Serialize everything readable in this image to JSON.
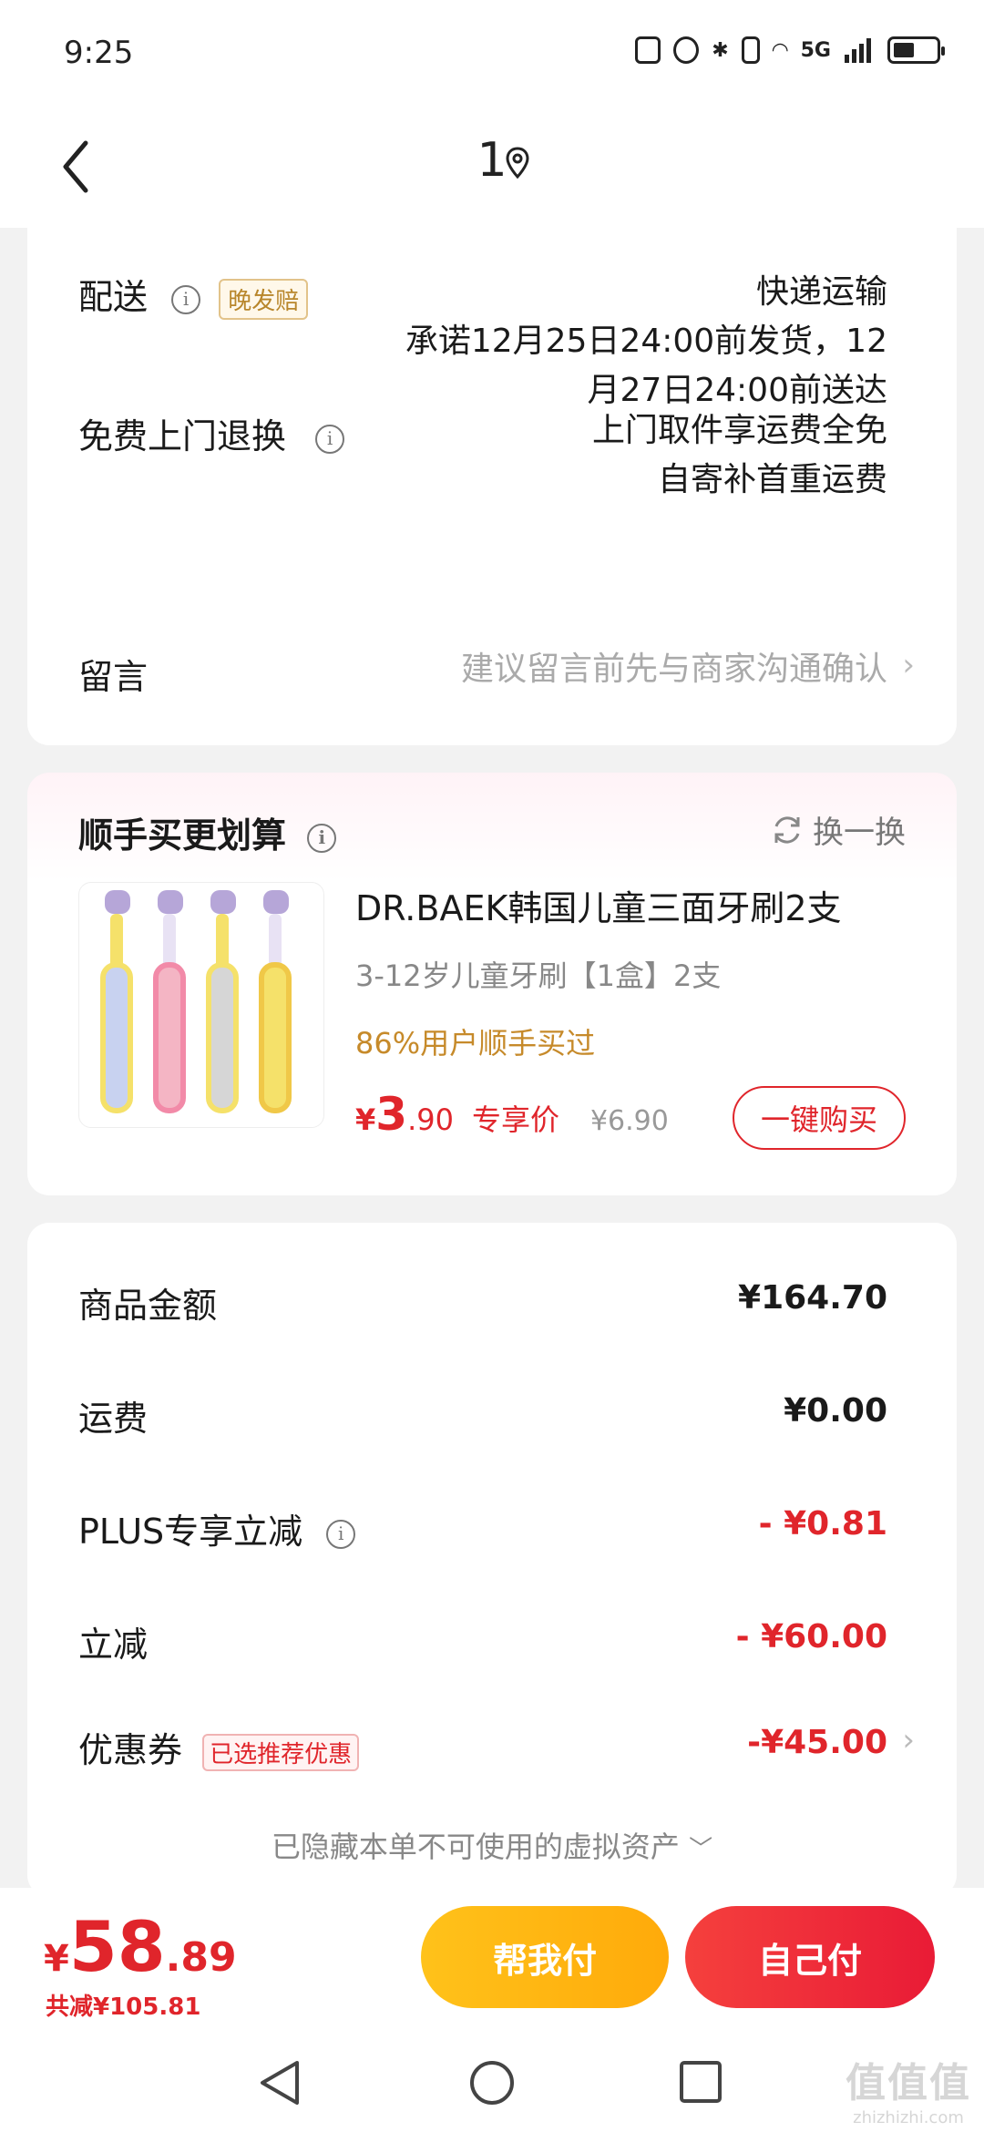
{
  "status_bar": {
    "time": "9:25",
    "network": "5G"
  },
  "nav": {
    "title": "1"
  },
  "delivery": {
    "label": "配送",
    "badge": "晚发赔",
    "method": "快递运输",
    "promise_line1": "承诺12月25日24:00前发货，12",
    "promise_line2": "月27日24:00前送达"
  },
  "returns": {
    "label": "免费上门退换",
    "line1": "上门取件享运费全免",
    "line2": "自寄补首重运费"
  },
  "message": {
    "label": "留言",
    "placeholder": "建议留言前先与商家沟通确认"
  },
  "addon": {
    "title": "顺手买更划算",
    "swap_label": "换一换",
    "product": {
      "name": "DR.BAEK韩国儿童三面牙刷2支",
      "spec": "3-12岁儿童牙刷【1盒】2支",
      "stat": "86%用户顺手买过",
      "currency": "¥",
      "price_int": "3",
      "price_dec": ".90",
      "price_tag": "专享价",
      "original_price": "¥6.90",
      "buy_label": "一键购买"
    }
  },
  "amounts": {
    "goods_label": "商品金额",
    "goods_value": "¥164.70",
    "shipping_label": "运费",
    "shipping_value": "¥0.00",
    "plus_label": "PLUS专享立减",
    "plus_value": "- ¥0.81",
    "discount_label": "立减",
    "discount_value": "- ¥60.00",
    "coupon_label": "优惠券",
    "coupon_badge": "已选推荐优惠",
    "coupon_value": "-¥45.00",
    "hidden_note": "已隐藏本单不可使用的虚拟资产"
  },
  "bottom": {
    "currency": "¥",
    "total_int": "58",
    "total_dec": ".89",
    "saved": "共减¥105.81",
    "help_pay": "帮我付",
    "self_pay": "自己付"
  },
  "watermark": {
    "big": "值值值",
    "small": "zhizhizhi.com"
  },
  "colors": {
    "accent_red": "#e0252b",
    "gold": "#c68a2a",
    "help_btn": "#ffb810",
    "self_btn": "#ec2a37"
  }
}
